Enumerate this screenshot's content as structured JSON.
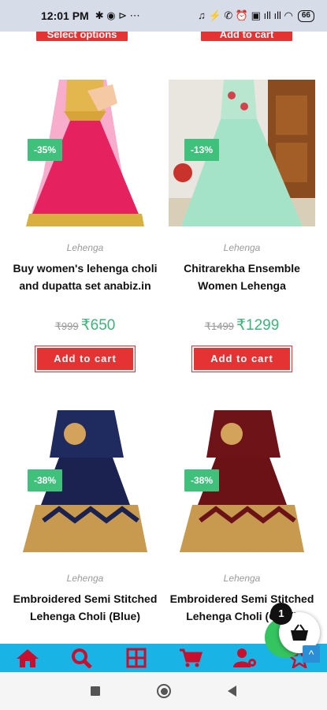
{
  "status_bar": {
    "time": "12:01 PM",
    "left_icons": "✱ ◉ ⊳ ⋯",
    "right_icons": "♫ ⚡ ✆ ⏰ ▣ ıll ıll ◠",
    "battery": "66"
  },
  "top_buttons": [
    "Select options",
    "Add to cart"
  ],
  "products": [
    {
      "badge": "-35%",
      "category": "Lehenga",
      "title": "Buy women's lehenga choli and dupatta set anabiz.in",
      "old_price": "₹999",
      "new_price": "₹650",
      "button": "Add to cart",
      "image": "pink-lehenga"
    },
    {
      "badge": "-13%",
      "category": "Lehenga",
      "title": "Chitrarekha Ensemble Women Lehenga",
      "old_price": "₹1499",
      "new_price": "₹1299",
      "button": "Add to cart",
      "image": "mint-lehenga"
    },
    {
      "badge": "-38%",
      "category": "Lehenga",
      "title": "Embroidered Semi Stitched Lehenga Choli (Blue)",
      "image": "blue-lehenga"
    },
    {
      "badge": "-38%",
      "category": "Lehenga",
      "title": "Embroidered Semi Stitched Lehenga Choli (Gold)",
      "image": "maroon-lehenga"
    }
  ],
  "cart_float": {
    "count": "1"
  },
  "bottom_nav": [
    "home-icon",
    "search-icon",
    "grid-icon",
    "cart-icon",
    "account-settings-icon",
    "wishlist-star-icon"
  ],
  "colors": {
    "accent_red": "#e53232",
    "sale_green": "#3fc07b",
    "price_green": "#3fb37a",
    "nav_blue": "#19b3e6"
  }
}
